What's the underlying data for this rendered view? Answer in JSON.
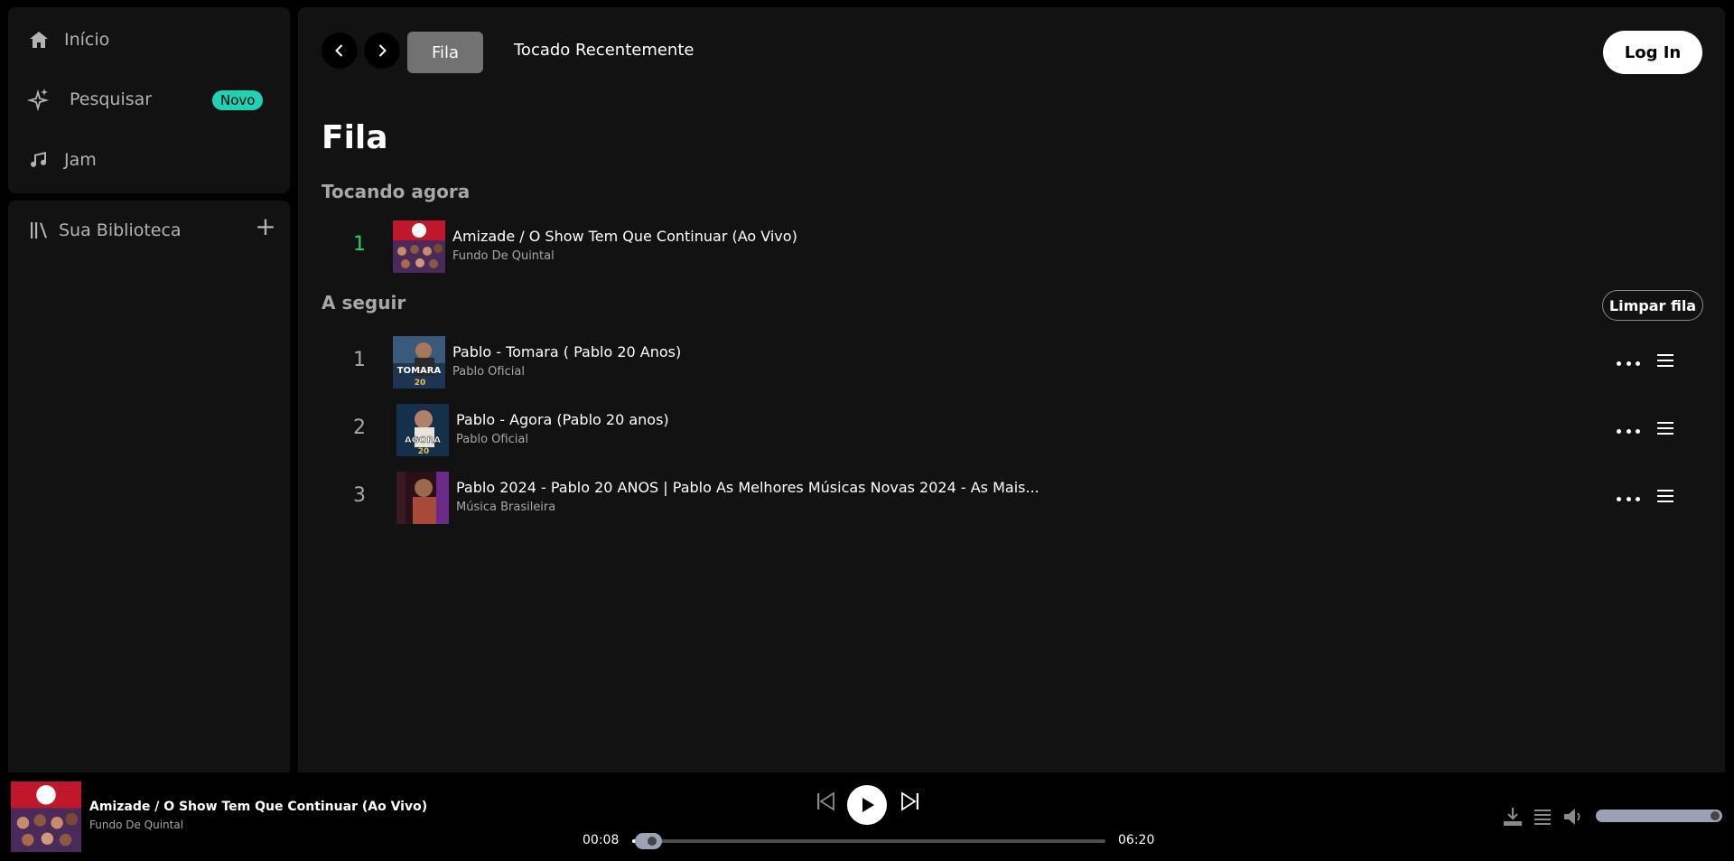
{
  "nav": {
    "home_label": "Início",
    "search_label": "Pesquisar",
    "search_badge": "Novo",
    "jam_label": "Jam"
  },
  "library": {
    "title": "Sua Biblioteca"
  },
  "header": {
    "tab_queue": "Fila",
    "tab_recent": "Tocado Recentemente",
    "login_label": "Log In"
  },
  "queue": {
    "title": "Fila",
    "now_playing_label": "Tocando agora",
    "next_label": "A seguir",
    "clear_label": "Limpar fila",
    "now_playing": {
      "num": "1",
      "title": "Amizade / O Show Tem Que Continuar (Ao Vivo)",
      "artist": "Fundo De Quintal"
    },
    "next": [
      {
        "num": "1",
        "title": "Pablo - Tomara ( Pablo 20 Anos)",
        "artist": "Pablo Oficial",
        "cover_text": "TOMARA"
      },
      {
        "num": "2",
        "title": "Pablo - Agora (Pablo 20 anos)",
        "artist": "Pablo Oficial",
        "cover_text": "AGORA"
      },
      {
        "num": "3",
        "title": "Pablo 2024 - Pablo 20 ANOS | Pablo As Melhores Músicas Novas 2024 - As Mais...",
        "artist": "Música Brasileira",
        "cover_text": ""
      }
    ]
  },
  "player": {
    "title": "Amizade / O Show Tem Que Continuar (Ao Vivo)",
    "artist": "Fundo De Quintal",
    "elapsed": "00:08",
    "duration": "06:20",
    "progress_fraction": 0.021,
    "volume_fraction": 1.0
  },
  "colors": {
    "accent": "#1ed760",
    "badge": "#1ed2b4",
    "panel": "#121212"
  }
}
